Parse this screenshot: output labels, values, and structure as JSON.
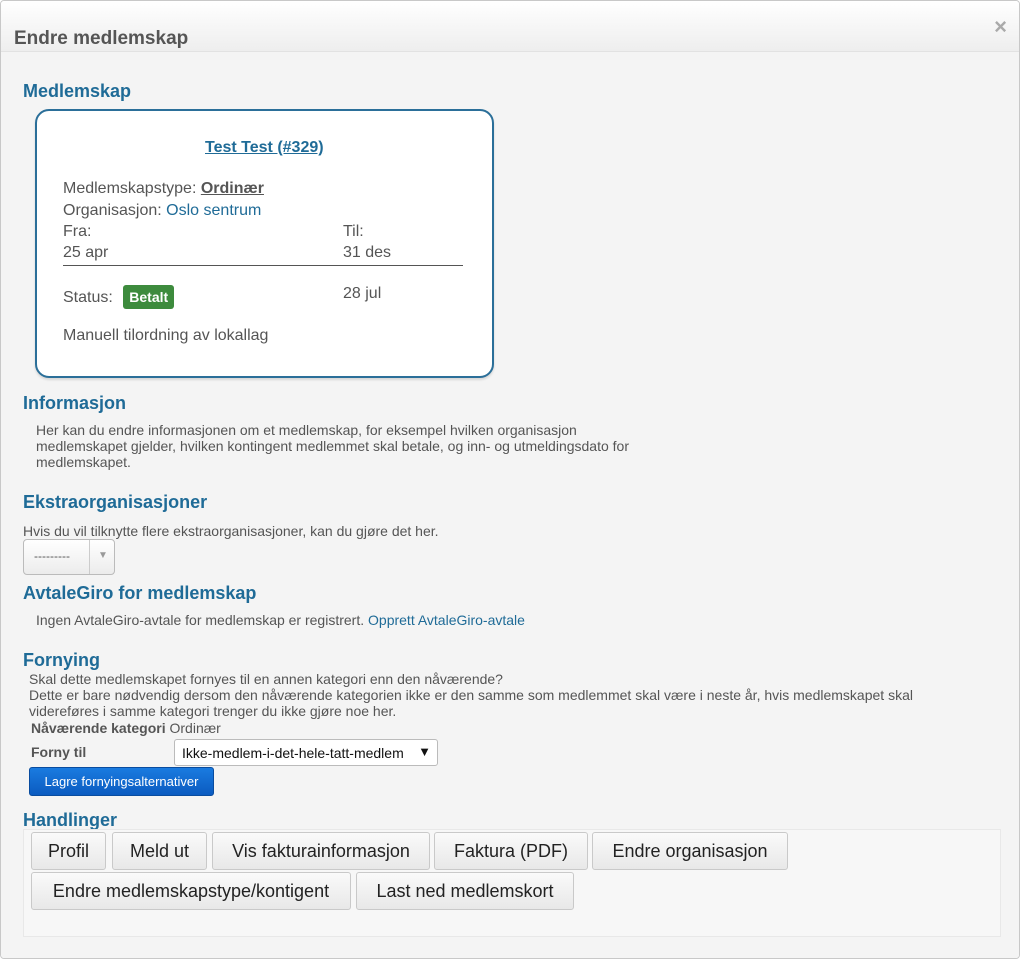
{
  "dialog": {
    "title": "Endre medlemskap",
    "close_label": "×"
  },
  "membership": {
    "heading": "Medlemskap",
    "member_name": "Test Test (#329)",
    "type_label": "Medlemskapstype:",
    "type_value": "Ordinær",
    "org_label": "Organisasjon:",
    "org_value": "Oslo sentrum",
    "from_label": "Fra:",
    "from_value": "25 apr",
    "to_label": "Til:",
    "to_value": "31 des",
    "status_label": "Status:",
    "status_value": "Betalt",
    "status_date": "28 jul",
    "note": "Manuell tilordning av lokallag"
  },
  "info": {
    "heading": "Informasjon",
    "lines": [
      "Her kan du endre informasjonen om et medlemskap, for eksempel hvilken organisasjon",
      "medlemskapet gjelder, hvilken kontingent medlemmet skal betale, og inn- og utmeldingsdato for",
      "medlemskapet."
    ]
  },
  "extra_orgs": {
    "heading": "Ekstraorganisasjoner",
    "description": "Hvis du vil tilknytte flere ekstraorganisasjoner, kan du gjøre det her.",
    "select_value": "---------"
  },
  "avtalegiro": {
    "heading": "AvtaleGiro for medlemskap",
    "text": "Ingen AvtaleGiro-avtale for medlemskap er registrert.",
    "link": "Opprett AvtaleGiro-avtale"
  },
  "renewal": {
    "heading": "Fornying",
    "lines": [
      "Skal dette medlemskapet fornyes til en annen kategori enn den nåværende?",
      "Dette er bare nødvendig dersom den nåværende kategorien ikke er den samme som medlemmet skal være i neste år, hvis medlemskapet skal",
      "videreføres i samme kategori trenger du ikke gjøre noe her."
    ],
    "current_label": "Nåværende kategori",
    "current_value": "Ordinær",
    "renew_label": "Forny til",
    "renew_value": "Ikke-medlem-i-det-hele-tatt-medlem",
    "save_label": "Lagre fornyingsalternativer"
  },
  "actions": {
    "heading": "Handlinger",
    "buttons": [
      "Profil",
      "Meld ut",
      "Vis fakturainformasjon",
      "Faktura (PDF)",
      "Endre organisasjon",
      "Endre medlemskapstype/kontigent",
      "Last ned medlemskort"
    ]
  }
}
